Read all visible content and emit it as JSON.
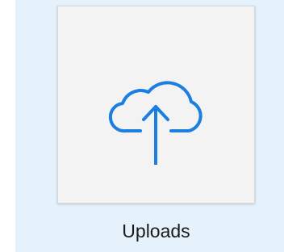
{
  "folder_tile": {
    "label": "Uploads",
    "icon": "cloud-upload-icon",
    "icon_color": "#1a7fe0",
    "selection_color": "#e5f1fb"
  }
}
